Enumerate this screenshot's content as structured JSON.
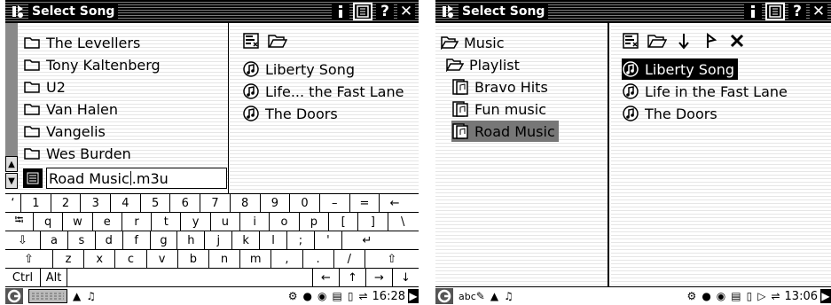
{
  "left": {
    "title": "Select Song",
    "title_buttons": {
      "help": "?",
      "close": "✕"
    },
    "folders": [
      "The Levellers",
      "Tony Kaltenberg",
      "U2",
      "Van Halen",
      "Vangelis",
      "Wes Burden"
    ],
    "filename_input": {
      "value_before_caret": "Road Music",
      "value_after_caret": ".m3u"
    },
    "songs": [
      "Liberty Song",
      "Life... the Fast Lane",
      "The Doors"
    ],
    "keyboard": {
      "row1": [
        "‘",
        "1",
        "2",
        "3",
        "4",
        "5",
        "6",
        "7",
        "8",
        "9",
        "0",
        "–",
        "=",
        "←"
      ],
      "row2": [
        "⭾",
        "q",
        "w",
        "e",
        "r",
        "t",
        "y",
        "u",
        "i",
        "o",
        "p",
        "[",
        "]",
        "\\"
      ],
      "row3": [
        "⇩",
        "a",
        "s",
        "d",
        "f",
        "g",
        "h",
        "j",
        "k",
        "l",
        ";",
        "'",
        "↵"
      ],
      "row4": [
        "⇧",
        "z",
        "x",
        "c",
        "v",
        "b",
        "n",
        "m",
        ",",
        ".",
        "/",
        "⇧"
      ],
      "row5": {
        "ctrl": "Ctrl",
        "alt": "Alt",
        "arrows": [
          "←",
          "↑",
          "→",
          "↓"
        ]
      }
    },
    "status": {
      "time": "16:28"
    }
  },
  "right": {
    "title": "Select Song",
    "title_buttons": {
      "help": "?",
      "close": "✕"
    },
    "tree": [
      {
        "label": "Music",
        "icon": "folder-open-icon"
      },
      {
        "label": "Playlist",
        "icon": "folder-open-icon"
      },
      {
        "label": "Bravo Hits",
        "icon": "playlist-icon"
      },
      {
        "label": "Fun music",
        "icon": "playlist-icon"
      },
      {
        "label": "Road Music",
        "icon": "playlist-icon"
      }
    ],
    "songs": [
      "Liberty Song",
      "Life in the Fast Lane",
      "The Doors"
    ],
    "status": {
      "input_mode": "abc",
      "time": "13:06"
    }
  }
}
